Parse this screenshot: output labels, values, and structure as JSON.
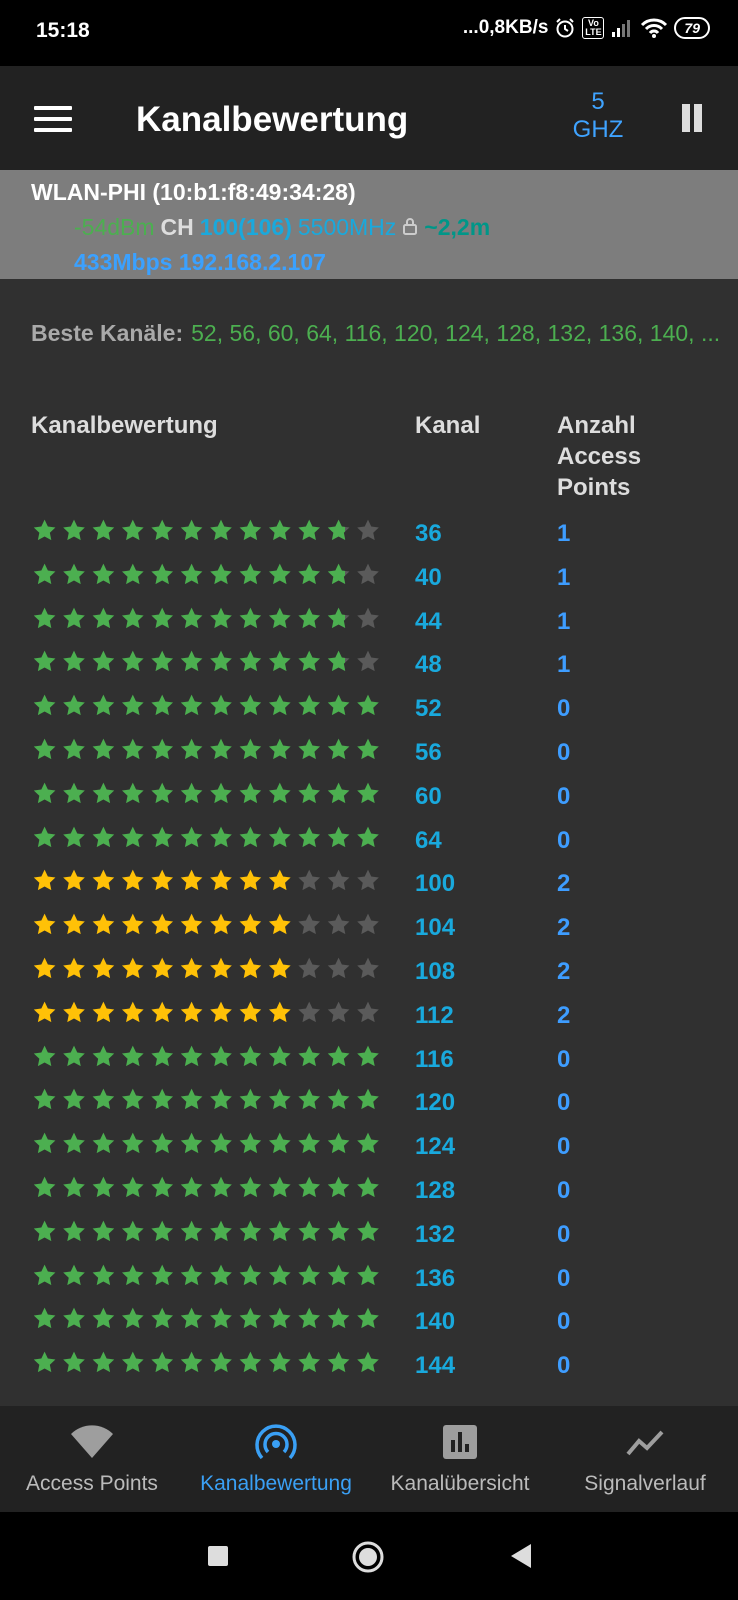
{
  "status_bar": {
    "time": "15:18",
    "net_speed": "...0,8KB/s",
    "battery": "79",
    "volte": "Vo LTE"
  },
  "app_bar": {
    "title": "Kanalbewertung",
    "band": "5 GHZ",
    "menu_icon": "hamburger-menu-icon",
    "pause_icon": "pause-icon"
  },
  "connection": {
    "ssid_line": "WLAN-PHI (10:b1:f8:49:34:28)",
    "signal": "-54dBm",
    "ch_label": "CH",
    "channel": "100(106)",
    "frequency": "5500MHz",
    "distance": "~2,2m",
    "speed_ip": "433Mbps 192.168.2.107",
    "colors": {
      "signal": "#4caf50",
      "channel": "#19a9dd",
      "frequency": "#19a9dd",
      "distance": "#009688",
      "speed": "#3ba1ff"
    }
  },
  "best_channels": {
    "label": "Beste Kanäle:",
    "values": "52, 56, 60, 64, 116, 120, 124, 128, 132, 136, 140, ..."
  },
  "table": {
    "headers": {
      "rating": "Kanalbewertung",
      "channel": "Kanal",
      "aps": "Anzahl Access Points"
    },
    "max_stars": 10,
    "colors": {
      "good": "#4caf50",
      "medium": "#ffc107",
      "empty": "#5a5a5a"
    },
    "rows": [
      {
        "channel": "36",
        "rating": 9,
        "color": "good",
        "aps": "1"
      },
      {
        "channel": "40",
        "rating": 9,
        "color": "good",
        "aps": "1"
      },
      {
        "channel": "44",
        "rating": 9,
        "color": "good",
        "aps": "1"
      },
      {
        "channel": "48",
        "rating": 9,
        "color": "good",
        "aps": "1"
      },
      {
        "channel": "52",
        "rating": 10,
        "color": "good",
        "aps": "0"
      },
      {
        "channel": "56",
        "rating": 10,
        "color": "good",
        "aps": "0"
      },
      {
        "channel": "60",
        "rating": 10,
        "color": "good",
        "aps": "0"
      },
      {
        "channel": "64",
        "rating": 10,
        "color": "good",
        "aps": "0"
      },
      {
        "channel": "100",
        "rating": 7.5,
        "color": "medium",
        "aps": "2"
      },
      {
        "channel": "104",
        "rating": 7.5,
        "color": "medium",
        "aps": "2"
      },
      {
        "channel": "108",
        "rating": 7.5,
        "color": "medium",
        "aps": "2"
      },
      {
        "channel": "112",
        "rating": 7.5,
        "color": "medium",
        "aps": "2"
      },
      {
        "channel": "116",
        "rating": 10,
        "color": "good",
        "aps": "0"
      },
      {
        "channel": "120",
        "rating": 10,
        "color": "good",
        "aps": "0"
      },
      {
        "channel": "124",
        "rating": 10,
        "color": "good",
        "aps": "0"
      },
      {
        "channel": "128",
        "rating": 10,
        "color": "good",
        "aps": "0"
      },
      {
        "channel": "132",
        "rating": 10,
        "color": "good",
        "aps": "0"
      },
      {
        "channel": "136",
        "rating": 10,
        "color": "good",
        "aps": "0"
      },
      {
        "channel": "140",
        "rating": 10,
        "color": "good",
        "aps": "0"
      },
      {
        "channel": "144",
        "rating": 10,
        "color": "good",
        "aps": "0"
      }
    ]
  },
  "bottom_nav": [
    {
      "label": "Access Points",
      "icon": "wifi-icon",
      "active": false
    },
    {
      "label": "Kanalbewertung",
      "icon": "radar-icon",
      "active": true
    },
    {
      "label": "Kanalübersicht",
      "icon": "bar-chart-icon",
      "active": false
    },
    {
      "label": "Signalverlauf",
      "icon": "line-chart-icon",
      "active": false
    }
  ],
  "system_nav": {
    "recents": "recents-icon",
    "home": "home-icon",
    "back": "back-icon"
  }
}
